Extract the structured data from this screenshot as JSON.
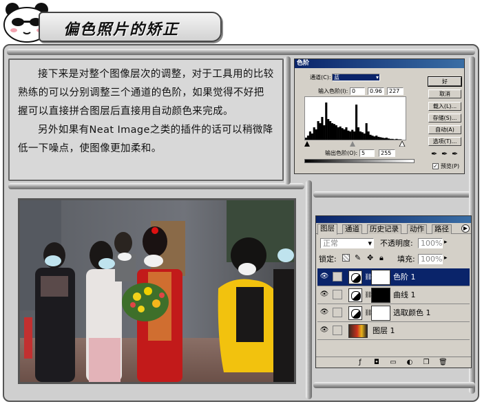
{
  "header": {
    "title": "偏色照片的矫正",
    "mascot_icon": "panda-face-icon"
  },
  "article": {
    "paragraphs": [
      "接下来是对整个图像层次的调整，对于工具用的比较熟练的可以分别调整三个通道的色阶，如果觉得不好把握可以直接拼合图层后直接用自动颜色来完成。",
      "另外如果有Neat Image之类的插件的话可以稍微降低一下噪点，使图像更加柔和。"
    ]
  },
  "levels_dialog": {
    "title": "色阶",
    "channel_label": "通道(C):",
    "channel_value": "蓝",
    "input_label": "输入色阶(I):",
    "input_values": [
      "0",
      "0.96",
      "227"
    ],
    "output_label": "输出色阶(O):",
    "output_values": [
      "5",
      "255"
    ],
    "buttons": [
      "好",
      "取消",
      "载入(L)...",
      "存储(S)...",
      "自动(A)",
      "选项(T)..."
    ],
    "preview_label": "预览(P)",
    "preview_checked": true,
    "histogram_peaks": [
      0.05,
      0.1,
      0.2,
      0.15,
      0.3,
      0.25,
      0.45,
      0.4,
      0.55,
      0.35,
      0.9,
      0.5,
      0.45,
      0.4,
      0.38,
      0.35,
      0.3,
      0.32,
      0.28,
      0.25,
      0.3,
      0.22,
      0.2,
      0.24,
      0.2,
      0.85,
      0.3,
      0.2,
      0.18,
      0.15,
      0.4,
      0.2,
      0.12,
      0.1,
      0.08,
      0.1,
      0.07,
      0.06,
      0.05,
      0.04,
      0.05,
      0.03,
      0.02,
      0.02,
      0.01,
      0.02,
      0.01,
      0.01,
      0.0,
      0.0
    ]
  },
  "layers_palette": {
    "tabs": [
      "图层",
      "通道",
      "历史记录",
      "动作",
      "路径"
    ],
    "blend_mode": "正常",
    "opacity_label": "不透明度:",
    "opacity_value": "100%",
    "lock_label": "锁定:",
    "fill_label": "填充:",
    "fill_value": "100%",
    "layers": [
      {
        "name": "色阶 1",
        "type": "adjustment",
        "selected": true
      },
      {
        "name": "曲线 1",
        "type": "adjustment",
        "selected": false
      },
      {
        "name": "选取颜色 1",
        "type": "adjustment",
        "selected": false
      },
      {
        "name": "图层 1",
        "type": "pixel",
        "selected": false
      }
    ]
  },
  "colors": {
    "accent": "#0a246a",
    "frame": "#cfcfcf",
    "dialog": "#d4d0c8"
  }
}
